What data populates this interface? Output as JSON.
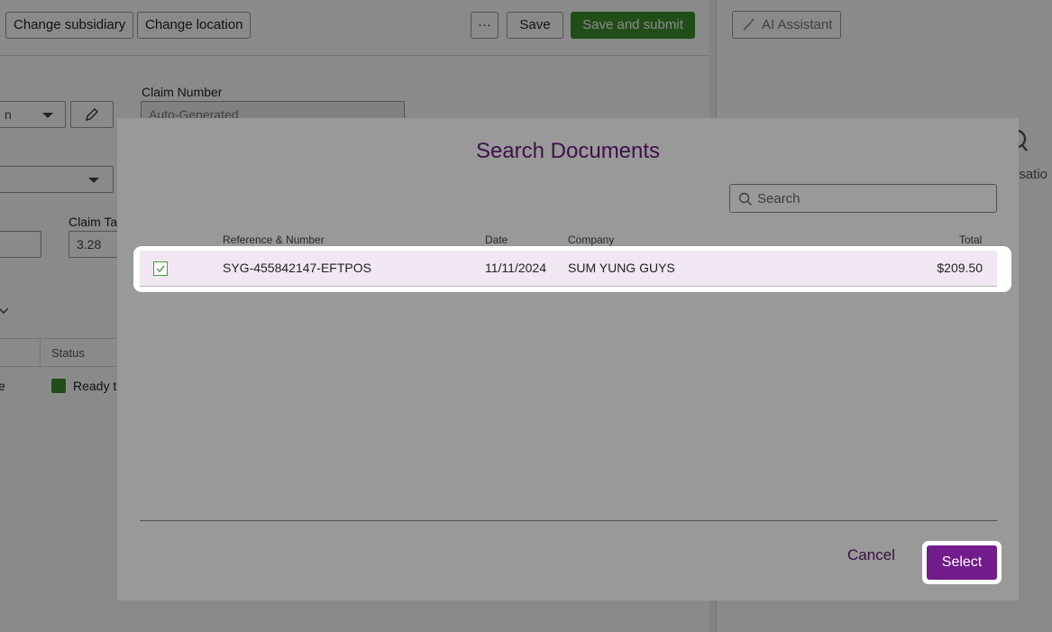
{
  "toolbar": {
    "change_subsidiary": "Change subsidiary",
    "change_location": "Change location",
    "more": "···",
    "save": "Save",
    "save_submit": "Save and submit"
  },
  "ai_panel": {
    "button_label": "AI Assistant",
    "partial_text": "ersatio"
  },
  "form": {
    "claim_number_label": "Claim Number",
    "claim_number_value": "Auto-Generated",
    "field1_partial": "n",
    "claim_tax_label": "Claim Tax",
    "claim_tax_value": "3.28"
  },
  "bg_table": {
    "status_header": "Status",
    "row_partial": "e",
    "status_value": "Ready to"
  },
  "modal": {
    "title": "Search Documents",
    "search_placeholder": "Search",
    "columns": {
      "reference": "Reference & Number",
      "date": "Date",
      "company": "Company",
      "total": "Total"
    },
    "rows": [
      {
        "reference": "SYG-455842147-EFTPOS",
        "date": "11/11/2024",
        "company": "SUM YUNG GUYS",
        "total": "$209.50",
        "checked": true
      }
    ],
    "cancel_label": "Cancel",
    "select_label": "Select"
  },
  "colors": {
    "accent_purple": "#711c8a",
    "title_purple": "#6a1b7e",
    "success_green": "#3e8e2e",
    "selected_row": "#f0e7f3"
  }
}
